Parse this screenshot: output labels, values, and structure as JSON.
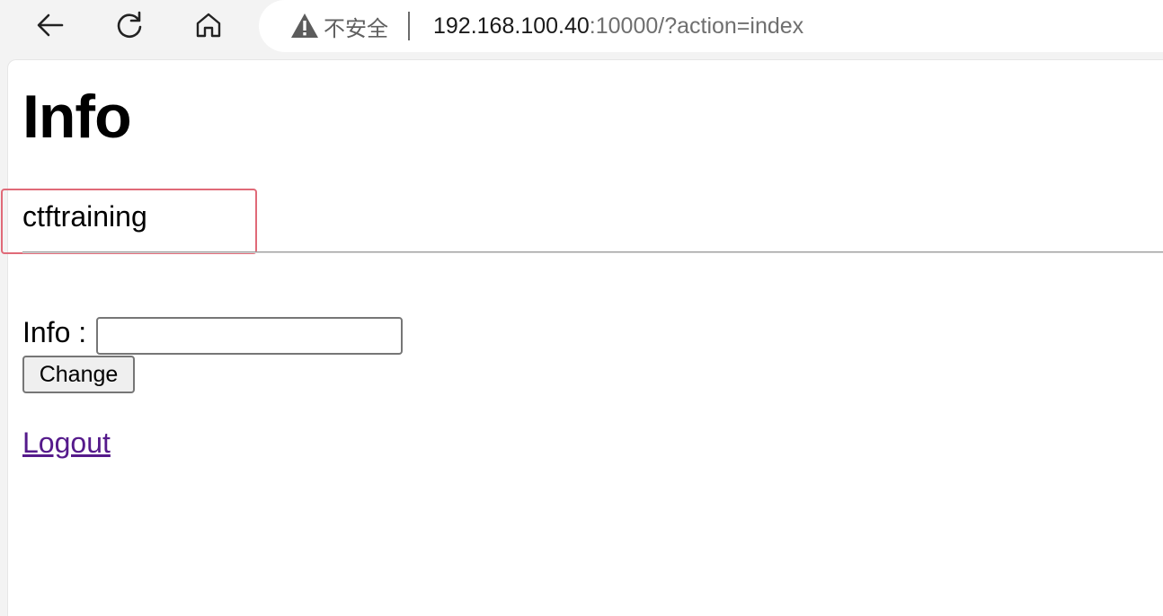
{
  "browser": {
    "back_icon": "arrow-left-icon",
    "reload_icon": "reload-icon",
    "home_icon": "home-icon",
    "security_icon": "warning-triangle-icon",
    "security_label": "不安全",
    "url_host": "192.168.100.40",
    "url_rest": ":10000/?action=index"
  },
  "page": {
    "title": "Info",
    "info_value": "ctftraining",
    "form": {
      "label": "Info :",
      "input_value": "",
      "submit_label": "Change"
    },
    "logout_label": "Logout"
  },
  "colors": {
    "highlight_border": "#e06a78",
    "visited_link": "#551a8b"
  }
}
